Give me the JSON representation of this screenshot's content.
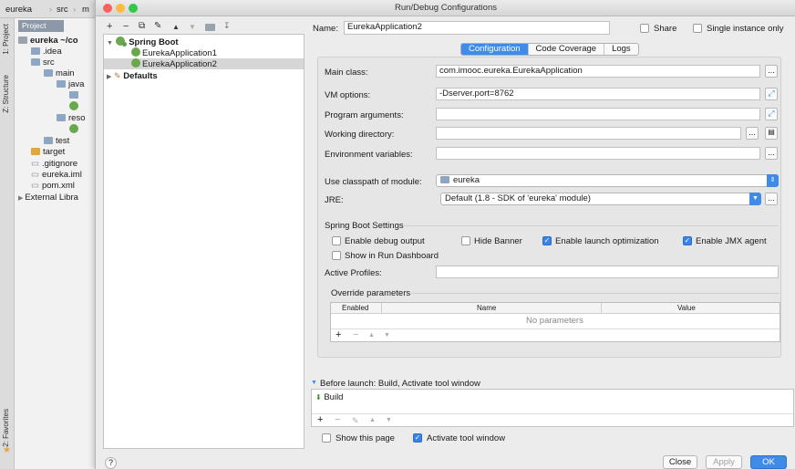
{
  "ide": {
    "breadcrumbs": [
      "eureka",
      "src",
      "m"
    ],
    "project_tab": "Project",
    "side_tabs": [
      "1: Project",
      "Z: Structure",
      "2: Favorites"
    ],
    "tree": [
      {
        "label": "eureka  ~/co",
        "indent": 0,
        "kind": "folder-g"
      },
      {
        "label": ".idea",
        "indent": 1,
        "kind": "folder"
      },
      {
        "label": "src",
        "indent": 1,
        "kind": "folder"
      },
      {
        "label": "main",
        "indent": 2,
        "kind": "folder"
      },
      {
        "label": "java",
        "indent": 3,
        "kind": "folder"
      },
      {
        "label": "",
        "indent": 4,
        "kind": "folder"
      },
      {
        "label": "",
        "indent": 4,
        "kind": "leaf"
      },
      {
        "label": "reso",
        "indent": 3,
        "kind": "folder"
      },
      {
        "label": "",
        "indent": 4,
        "kind": "leaf"
      },
      {
        "label": "test",
        "indent": 2,
        "kind": "folder"
      },
      {
        "label": "target",
        "indent": 1,
        "kind": "folder-o"
      },
      {
        "label": ".gitignore",
        "indent": 1,
        "kind": "file"
      },
      {
        "label": "eureka.iml",
        "indent": 1,
        "kind": "file"
      },
      {
        "label": "pom.xml",
        "indent": 1,
        "kind": "file"
      },
      {
        "label": "External Libra",
        "indent": 0,
        "kind": "lib"
      }
    ]
  },
  "dialog": {
    "title": "Run/Debug Configurations",
    "toolbar_icons": [
      "add-icon",
      "remove-icon",
      "copy-icon",
      "wrench-icon",
      "up-icon",
      "down-icon",
      "folder-icon",
      "sort-icon"
    ],
    "tree": {
      "spring_boot": "Spring Boot",
      "items": [
        "EurekaApplication1",
        "EurekaApplication2"
      ],
      "defaults": "Defaults"
    },
    "name_label": "Name:",
    "name_value": "EurekaApplication2",
    "share_label": "Share",
    "single_instance_label": "Single instance only",
    "tabs": [
      "Configuration",
      "Code Coverage",
      "Logs"
    ],
    "fields": {
      "main_class_label": "Main class:",
      "main_class_value": "com.imooc.eureka.EurekaApplication",
      "vm_options_label": "VM options:",
      "vm_options_value": "-Dserver.port=8762",
      "program_args_label": "Program arguments:",
      "working_dir_label": "Working directory:",
      "env_vars_label": "Environment variables:",
      "classpath_label": "Use classpath of module:",
      "classpath_value": "eureka",
      "jre_label": "JRE:",
      "jre_value": "Default (1.8 - SDK of 'eureka' module)"
    },
    "spring_boot_settings": {
      "title": "Spring Boot Settings",
      "enable_debug": "Enable debug output",
      "hide_banner": "Hide Banner",
      "enable_launch_opt": "Enable launch optimization",
      "enable_jmx": "Enable JMX agent",
      "show_dashboard": "Show in Run Dashboard",
      "active_profiles_label": "Active Profiles:"
    },
    "override": {
      "title": "Override parameters",
      "columns": [
        "Enabled",
        "Name",
        "Value"
      ],
      "empty_text": "No parameters"
    },
    "before_launch": {
      "title": "Before launch: Build, Activate tool window",
      "item": "Build"
    },
    "show_this_page": "Show this page",
    "activate_tool_window": "Activate tool window",
    "buttons": {
      "close": "Close",
      "apply": "Apply",
      "ok": "OK"
    },
    "help": "?",
    "dots": "..."
  }
}
